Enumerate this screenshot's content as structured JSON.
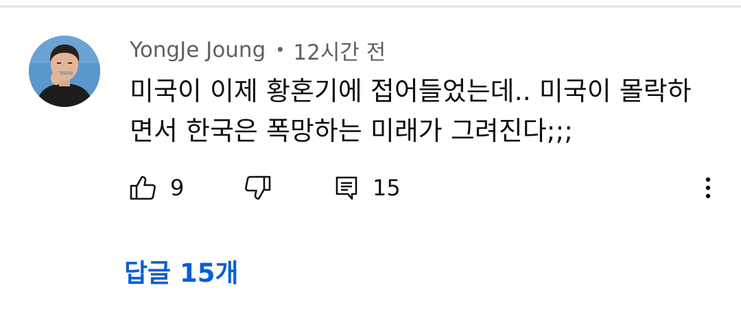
{
  "comment": {
    "author": "YongJe Joung",
    "separator": "•",
    "time": "12시간 전",
    "text_lines": [
      "미국이 이제 황혼기에 접어들었는데.. 미국이 몰락하",
      "면서 한국은 폭망하는 미래가 그려진다;;;"
    ]
  },
  "actions": {
    "like_count": "9",
    "reply_count": "15",
    "like_icon": "thumbs-up-icon",
    "dislike_icon": "thumbs-down-icon",
    "reply_icon": "comment-icon",
    "more_icon": "more-vertical-icon"
  },
  "replies": {
    "label": "답글 15개"
  },
  "colors": {
    "link_blue": "#065fd4",
    "meta_gray": "#606060",
    "text": "#0f0f0f"
  }
}
